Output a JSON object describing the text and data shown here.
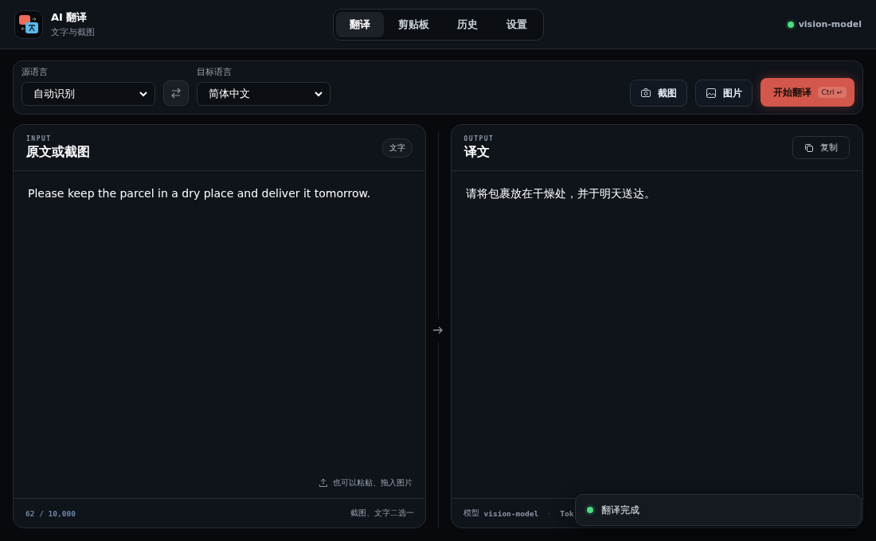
{
  "app": {
    "title": "AI 翻译",
    "subtitle": "文字与截图"
  },
  "tabs": [
    {
      "label": "翻译",
      "selected": true
    },
    {
      "label": "剪贴板",
      "selected": false
    },
    {
      "label": "历史",
      "selected": false
    },
    {
      "label": "设置",
      "selected": false
    }
  ],
  "model_status": {
    "label": "vision-model",
    "online": true
  },
  "toolbar": {
    "source": {
      "label": "源语言",
      "value": "自动识别"
    },
    "target": {
      "label": "目标语言",
      "value": "简体中文"
    },
    "buttons": [
      {
        "kind": "screenshot",
        "label": "截图"
      },
      {
        "kind": "image",
        "label": "图片"
      }
    ],
    "primary": {
      "label": "开始翻译",
      "shortcut": "Ctrl ↵"
    }
  },
  "input_panel": {
    "eyebrow": "INPUT",
    "title": "原文或截图",
    "mode_badge": "文字",
    "text": "Please keep the parcel in a dry place and deliver it tomorrow.",
    "hint": "也可以粘贴、拖入图片",
    "counter": "62 / 10,000",
    "footer_note": "截图、文字二选一"
  },
  "output_panel": {
    "eyebrow": "OUTPUT",
    "title": "译文",
    "copy_label": "复制",
    "text": "请将包裹放在干燥处，并于明天送达。",
    "footer": {
      "model_label": "模型",
      "model_value": "vision-model",
      "separator": "·",
      "partial": "Tok"
    }
  },
  "toast": {
    "message": "翻译完成",
    "success": true
  }
}
